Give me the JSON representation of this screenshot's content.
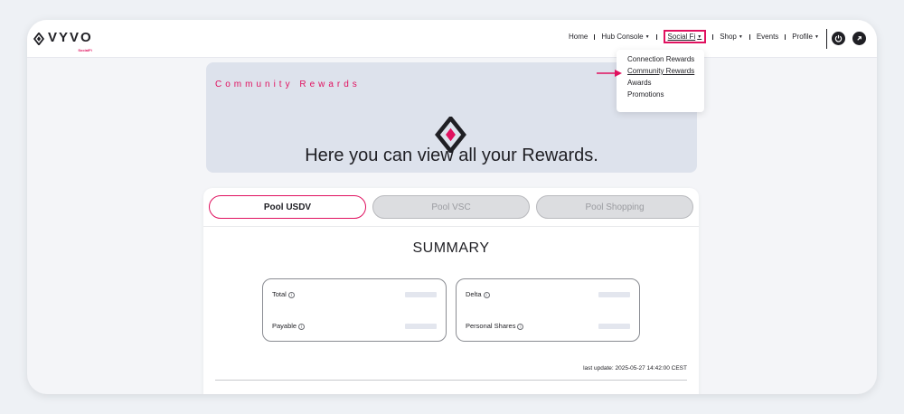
{
  "brand": {
    "name": "VYVO",
    "sub": "SocialFi",
    "accent": "#e0115f"
  },
  "nav": {
    "items": [
      {
        "label": "Home",
        "caret": false
      },
      {
        "label": "Hub Console",
        "caret": true
      },
      {
        "label": "Social Fi",
        "caret": true,
        "active": true
      },
      {
        "label": "Shop",
        "caret": true
      },
      {
        "label": "Events",
        "caret": false
      },
      {
        "label": "Profile",
        "caret": true
      }
    ],
    "icons": [
      "power-icon",
      "profile-circle-icon"
    ]
  },
  "dropdown": {
    "items": [
      "Connection Rewards",
      "Community Rewards",
      "Awards",
      "Promotions"
    ],
    "active_index": 1
  },
  "hero": {
    "title": "Community Rewards",
    "text": "Here you can view all your Rewards."
  },
  "tabs": [
    "Pool USDV",
    "Pool VSC",
    "Pool Shopping"
  ],
  "summary": {
    "title": "SUMMARY",
    "left": [
      "Total",
      "Payable"
    ],
    "right": [
      "Delta",
      "Personal Shares"
    ],
    "info_icon": "ⓘ"
  },
  "last_update": "last update: 2025-05-27 14:42:00 CEST"
}
